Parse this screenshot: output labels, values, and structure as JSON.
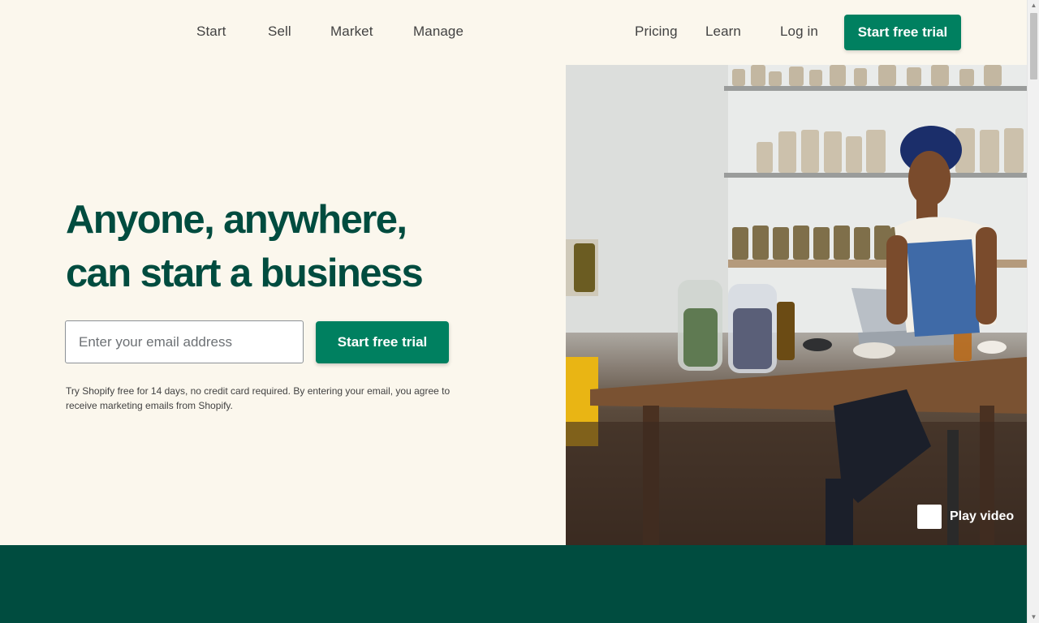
{
  "nav": {
    "primary": [
      "Start",
      "Sell",
      "Market",
      "Manage"
    ],
    "secondary": [
      "Pricing",
      "Learn"
    ],
    "login": "Log in",
    "cta": "Start free trial"
  },
  "hero": {
    "title_line1": "Anyone, anywhere,",
    "title_line2": "can start a business",
    "email_placeholder": "Enter your email address",
    "cta": "Start free trial",
    "disclaimer": "Try Shopify free for 14 days, no credit card required. By entering your email, you agree to receive marketing emails from Shopify."
  },
  "media": {
    "image_description": "shop-owner-with-tablet-and-jars",
    "play_label": "Play video"
  },
  "colors": {
    "brand_green": "#008060",
    "dark_green": "#004c3f",
    "background": "#fbf7ed"
  }
}
